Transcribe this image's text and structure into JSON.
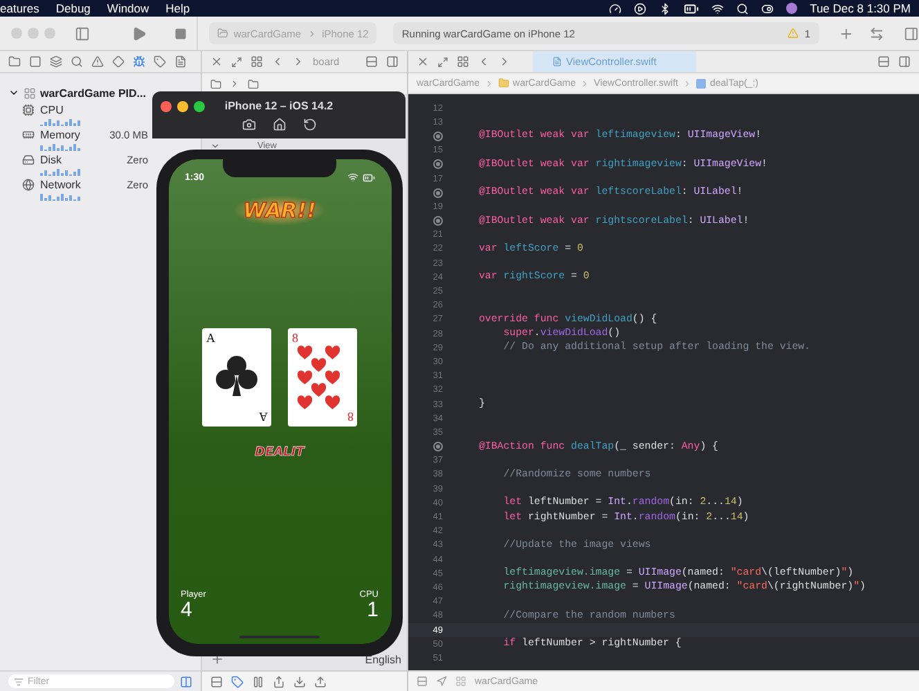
{
  "menu_bar": {
    "items": [
      "eatures",
      "Debug",
      "Window",
      "Help"
    ],
    "clock": "Tue Dec 8  1:30 PM"
  },
  "toolbar": {
    "scheme": "warCardGame",
    "device": "iPhone 12",
    "status": "Running warCardGame on iPhone 12",
    "warning_count": "1"
  },
  "navigator": {
    "process": "warCardGame PID...",
    "expanded": true,
    "gauges": [
      {
        "kind": "cpu",
        "name": "CPU"
      },
      {
        "kind": "memory",
        "name": "Memory",
        "value": "30.0 MB"
      },
      {
        "kind": "disk",
        "name": "Disk",
        "value": "Zero"
      },
      {
        "kind": "network",
        "name": "Network",
        "value": "Zero"
      }
    ],
    "filter_placeholder": "Filter"
  },
  "middle": {
    "tab": "board",
    "jump": "View",
    "language": "English"
  },
  "editor": {
    "tab": "ViewController.swift",
    "breadcrumbs": [
      "warCardGame",
      "warCardGame",
      "ViewController.swift",
      "dealTap(_:)"
    ],
    "lines": [
      {
        "number": "12"
      },
      {
        "number": "13"
      },
      {
        "kind": "outlet",
        "tokens": [
          {
            "kind": "kw",
            "text": "@IBOutlet weak var "
          },
          {
            "kind": "decl",
            "text": "leftimageview"
          },
          {
            "kind": "plain",
            "text": ": "
          },
          {
            "kind": "type",
            "text": "UIImageView"
          },
          {
            "kind": "plain",
            "text": "!"
          }
        ]
      },
      {
        "number": "15"
      },
      {
        "kind": "outlet",
        "tokens": [
          {
            "kind": "kw",
            "text": "@IBOutlet weak var "
          },
          {
            "kind": "decl",
            "text": "rightimageview"
          },
          {
            "kind": "plain",
            "text": ": "
          },
          {
            "kind": "type",
            "text": "UIImageView"
          },
          {
            "kind": "plain",
            "text": "!"
          }
        ]
      },
      {
        "number": "17"
      },
      {
        "kind": "outlet",
        "tokens": [
          {
            "kind": "kw",
            "text": "@IBOutlet weak var "
          },
          {
            "kind": "decl",
            "text": "leftscoreLabel"
          },
          {
            "kind": "plain",
            "text": ": "
          },
          {
            "kind": "type",
            "text": "UILabel"
          },
          {
            "kind": "plain",
            "text": "!"
          }
        ]
      },
      {
        "number": "19"
      },
      {
        "kind": "outlet",
        "tokens": [
          {
            "kind": "kw",
            "text": "@IBOutlet weak var "
          },
          {
            "kind": "decl",
            "text": "rightscoreLabel"
          },
          {
            "kind": "plain",
            "text": ": "
          },
          {
            "kind": "type",
            "text": "UILabel"
          },
          {
            "kind": "plain",
            "text": "!"
          }
        ]
      },
      {
        "number": "21"
      },
      {
        "number": "22",
        "tokens": [
          {
            "kind": "kw",
            "text": "var "
          },
          {
            "kind": "decl",
            "text": "leftScore"
          },
          {
            "kind": "plain",
            "text": " = "
          },
          {
            "kind": "num",
            "text": "0"
          }
        ]
      },
      {
        "number": "23"
      },
      {
        "number": "24",
        "tokens": [
          {
            "kind": "kw",
            "text": "var "
          },
          {
            "kind": "decl",
            "text": "rightScore"
          },
          {
            "kind": "plain",
            "text": " = "
          },
          {
            "kind": "num",
            "text": "0"
          }
        ]
      },
      {
        "number": "25"
      },
      {
        "number": "26"
      },
      {
        "number": "27",
        "tokens": [
          {
            "kind": "kw",
            "text": "override func "
          },
          {
            "kind": "decl",
            "text": "viewDidLoad"
          },
          {
            "kind": "plain",
            "text": "() {"
          }
        ]
      },
      {
        "number": "28",
        "tokens": [
          {
            "kind": "kw",
            "text": "    super"
          },
          {
            "kind": "plain",
            "text": "."
          },
          {
            "kind": "method",
            "text": "viewDidLoad"
          },
          {
            "kind": "plain",
            "text": "()"
          }
        ]
      },
      {
        "number": "29",
        "tokens": [
          {
            "kind": "comment",
            "text": "    // Do any additional setup after loading the view."
          }
        ]
      },
      {
        "number": "30"
      },
      {
        "number": "31"
      },
      {
        "number": "32"
      },
      {
        "number": "33",
        "tokens": [
          {
            "kind": "plain",
            "text": "}"
          }
        ]
      },
      {
        "number": "34"
      },
      {
        "number": "35"
      },
      {
        "kind": "outlet",
        "tokens": [
          {
            "kind": "kw",
            "text": "@IBAction func "
          },
          {
            "kind": "decl",
            "text": "dealTap"
          },
          {
            "kind": "plain",
            "text": "(_ sender: "
          },
          {
            "kind": "kw",
            "text": "Any"
          },
          {
            "kind": "plain",
            "text": ") {"
          }
        ]
      },
      {
        "number": "37"
      },
      {
        "number": "38",
        "tokens": [
          {
            "kind": "comment",
            "text": "    //Randomize some numbers"
          }
        ]
      },
      {
        "number": "39"
      },
      {
        "number": "40",
        "tokens": [
          {
            "kind": "kw",
            "text": "    let "
          },
          {
            "kind": "plain",
            "text": "leftNumber = "
          },
          {
            "kind": "type",
            "text": "Int"
          },
          {
            "kind": "plain",
            "text": "."
          },
          {
            "kind": "method",
            "text": "random"
          },
          {
            "kind": "plain",
            "text": "(in: "
          },
          {
            "kind": "num",
            "text": "2"
          },
          {
            "kind": "plain",
            "text": "..."
          },
          {
            "kind": "num",
            "text": "14"
          },
          {
            "kind": "plain",
            "text": ")"
          }
        ]
      },
      {
        "number": "41",
        "tokens": [
          {
            "kind": "kw",
            "text": "    let "
          },
          {
            "kind": "plain",
            "text": "rightNumber = "
          },
          {
            "kind": "type",
            "text": "Int"
          },
          {
            "kind": "plain",
            "text": "."
          },
          {
            "kind": "method",
            "text": "random"
          },
          {
            "kind": "plain",
            "text": "(in: "
          },
          {
            "kind": "num",
            "text": "2"
          },
          {
            "kind": "plain",
            "text": "..."
          },
          {
            "kind": "num",
            "text": "14"
          },
          {
            "kind": "plain",
            "text": ")"
          }
        ]
      },
      {
        "number": "42"
      },
      {
        "number": "43",
        "tokens": [
          {
            "kind": "comment",
            "text": "    //Update the image views"
          }
        ]
      },
      {
        "number": "44"
      },
      {
        "number": "45",
        "tokens": [
          {
            "kind": "prop",
            "text": "    leftimageview.image"
          },
          {
            "kind": "plain",
            "text": " = "
          },
          {
            "kind": "type",
            "text": "UIImage"
          },
          {
            "kind": "plain",
            "text": "(named: "
          },
          {
            "kind": "str",
            "text": "\"card"
          },
          {
            "kind": "plain",
            "text": "\\(leftNumber)"
          },
          {
            "kind": "str",
            "text": "\""
          },
          {
            "kind": "plain",
            "text": ")"
          }
        ]
      },
      {
        "number": "46",
        "tokens": [
          {
            "kind": "prop",
            "text": "    rightimageview.image"
          },
          {
            "kind": "plain",
            "text": " = "
          },
          {
            "kind": "type",
            "text": "UIImage"
          },
          {
            "kind": "plain",
            "text": "(named: "
          },
          {
            "kind": "str",
            "text": "\"card"
          },
          {
            "kind": "plain",
            "text": "\\(rightNumber)"
          },
          {
            "kind": "str",
            "text": "\""
          },
          {
            "kind": "plain",
            "text": ")"
          }
        ]
      },
      {
        "number": "47"
      },
      {
        "number": "48",
        "tokens": [
          {
            "kind": "comment",
            "text": "    //Compare the random numbers"
          }
        ]
      },
      {
        "number": "49",
        "current": true
      },
      {
        "number": "50",
        "tokens": [
          {
            "kind": "kw",
            "text": "    if "
          },
          {
            "kind": "plain",
            "text": "leftNumber > rightNumber {"
          }
        ]
      },
      {
        "number": "51"
      }
    ]
  },
  "debug_bar": {
    "target": "warCardGame"
  },
  "simulator": {
    "title": "iPhone 12 – iOS 14.2",
    "time": "1:30",
    "logo": "WAR!!",
    "cards": [
      {
        "kind": "clubs",
        "ranks": [
          "A",
          "A"
        ]
      },
      {
        "kind": "hearts",
        "ranks": [
          "8",
          "8"
        ]
      }
    ],
    "button": "DEALIT",
    "scores": [
      {
        "label": "Player",
        "value": "4"
      },
      {
        "label": "CPU",
        "value": "1"
      }
    ]
  }
}
